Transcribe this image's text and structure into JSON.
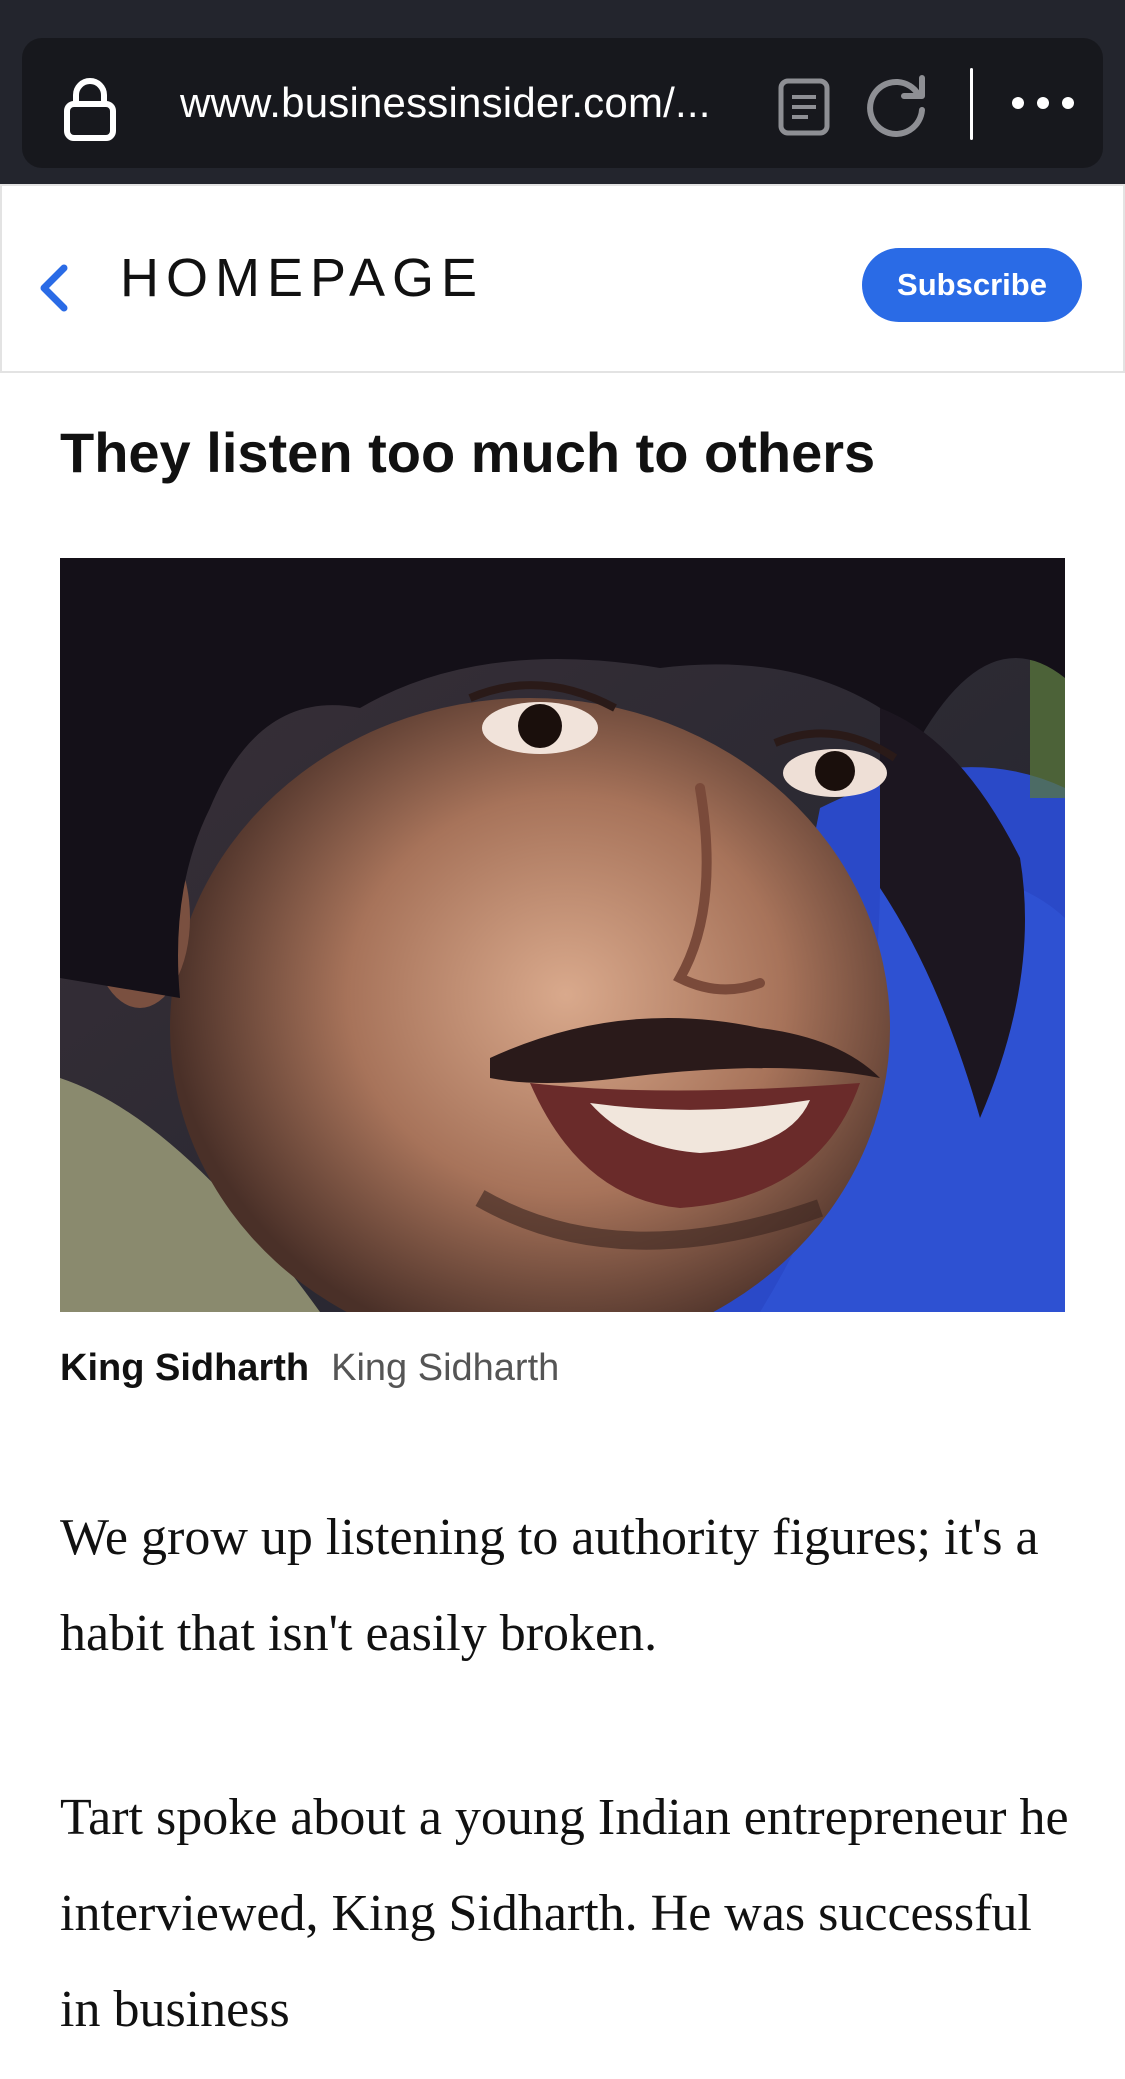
{
  "browser": {
    "url": "www.businessinsider.com/..."
  },
  "header": {
    "title": "HOMEPAGE",
    "subscribe_label": "Subscribe"
  },
  "article": {
    "headline": "They listen too much to others",
    "image_caption_name": "King Sidharth",
    "image_caption_source": "King Sidharth",
    "paragraphs": [
      "We grow up listening to authority figures; it's a habit that isn't easily broken.",
      "Tart spoke about a young Indian entrepreneur he interviewed, King Sidharth. He was successful in business"
    ]
  },
  "colors": {
    "chrome_bg": "#23252d",
    "urlbar_bg": "#17181d",
    "accent": "#2a6be6"
  },
  "icons": [
    "lock-icon",
    "reader-view-icon",
    "reload-icon",
    "more-icon",
    "back-chevron-icon"
  ]
}
